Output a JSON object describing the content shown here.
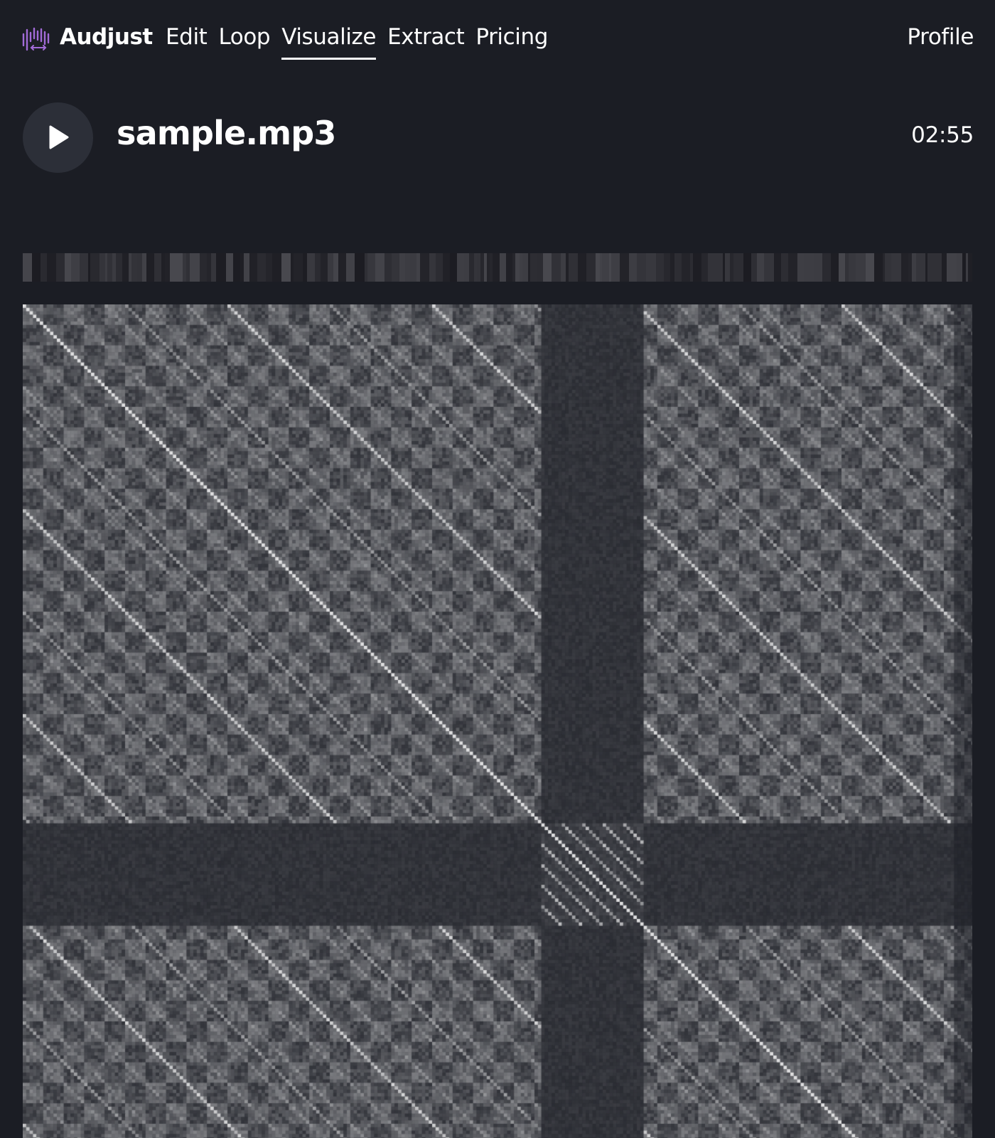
{
  "app": {
    "brand": "Audjust",
    "brand_color": "#a26bd8",
    "logo_icon": "waveform-arrows-icon"
  },
  "nav": {
    "items": [
      {
        "label": "Edit",
        "active": false
      },
      {
        "label": "Loop",
        "active": false
      },
      {
        "label": "Visualize",
        "active": true
      },
      {
        "label": "Extract",
        "active": false
      },
      {
        "label": "Pricing",
        "active": false
      }
    ],
    "profile_label": "Profile"
  },
  "player": {
    "play_icon": "play-icon",
    "file_name": "sample.mp3",
    "duration": "02:55"
  },
  "colors": {
    "background": "#1b1d24",
    "button_bg": "#2c2f38",
    "wave_cyan": "#8ef0f0",
    "wave_green": "#9cf59c",
    "wave_blue": "#8fa3f0",
    "wave_purple": "#c890f0"
  }
}
